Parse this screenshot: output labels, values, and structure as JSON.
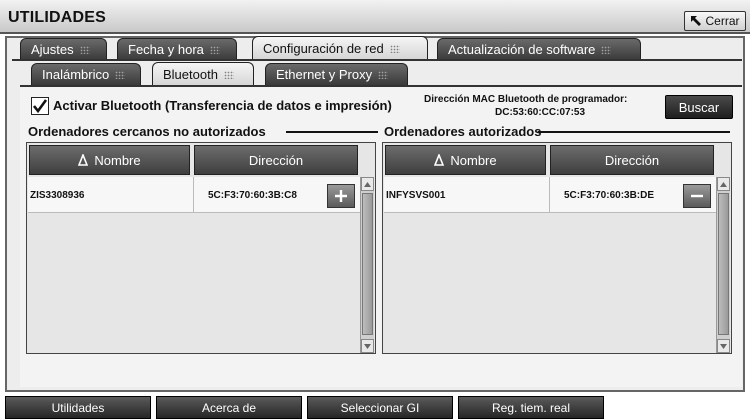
{
  "window": {
    "title": "UTILIDADES",
    "close_label": "Cerrar"
  },
  "main_tabs": [
    {
      "label": "Ajustes",
      "active": false
    },
    {
      "label": "Fecha y hora",
      "active": false
    },
    {
      "label": "Configuración de red",
      "active": true
    },
    {
      "label": "Actualización de software",
      "active": false
    }
  ],
  "sub_tabs": [
    {
      "label": "Inalámbrico",
      "active": false
    },
    {
      "label": "Bluetooth",
      "active": true
    },
    {
      "label": "Ethernet y Proxy",
      "active": false
    }
  ],
  "bluetooth": {
    "enable_label": "Activar Bluetooth (Transferencia de datos e impresión)",
    "enabled": true,
    "mac_label": "Dirección MAC Bluetooth de programador:",
    "mac_value": "DC:53:60:CC:07:53",
    "search_label": "Buscar"
  },
  "nearby_unauthorized": {
    "title": "Ordenadores cercanos no autorizados",
    "columns": [
      "Nombre",
      "Dirección"
    ],
    "rows": [
      {
        "name": "ZIS3308936",
        "address": "5C:F3:70:60:3B:C8",
        "action_icon": "plus-icon"
      }
    ]
  },
  "authorized": {
    "title": "Ordenadores autorizados",
    "columns": [
      "Nombre",
      "Dirección"
    ],
    "rows": [
      {
        "name": "INFYSVS001",
        "address": "5C:F3:70:60:3B:DE",
        "action_icon": "minus-icon"
      }
    ]
  },
  "bottom_nav": [
    {
      "label": "Utilidades"
    },
    {
      "label": "Acerca de"
    },
    {
      "label": "Seleccionar GI"
    },
    {
      "label": "Reg. tiem. real"
    }
  ]
}
